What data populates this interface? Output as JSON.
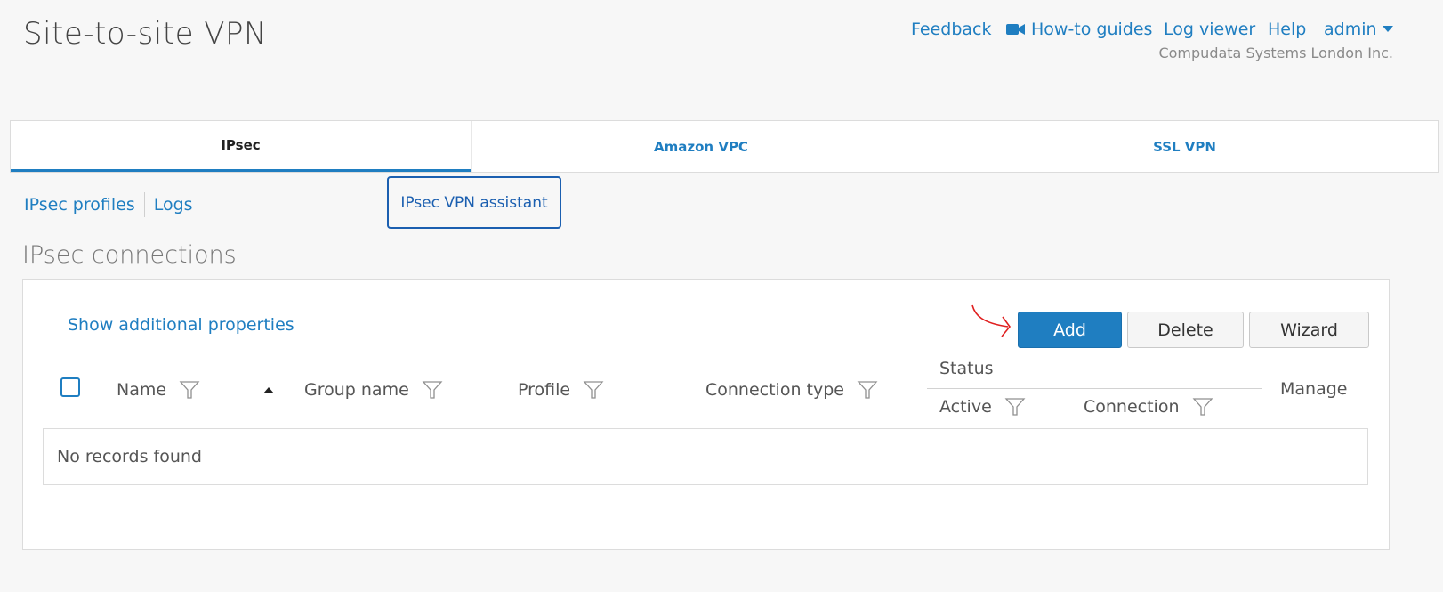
{
  "header": {
    "title": "Site-to-site VPN",
    "links": {
      "feedback": "Feedback",
      "howto": "How-to guides",
      "logviewer": "Log viewer",
      "help": "Help",
      "user": "admin"
    },
    "company": "Compudata Systems London Inc."
  },
  "tabs": [
    {
      "label": "IPsec",
      "active": true
    },
    {
      "label": "Amazon VPC",
      "active": false
    },
    {
      "label": "SSL VPN",
      "active": false
    }
  ],
  "subnav": {
    "profiles": "IPsec profiles",
    "logs": "Logs",
    "assistant": "IPsec VPN assistant"
  },
  "section": {
    "title": "IPsec connections",
    "show_props": "Show additional properties",
    "buttons": {
      "add": "Add",
      "delete": "Delete",
      "wizard": "Wizard"
    },
    "table": {
      "columns": {
        "name": "Name",
        "group": "Group name",
        "profile": "Profile",
        "conn_type": "Connection type",
        "status": "Status",
        "active": "Active",
        "connection": "Connection",
        "manage": "Manage"
      },
      "empty": "No records found"
    }
  },
  "colors": {
    "accent": "#1f7ec1",
    "highlight_border": "#1b5fb0",
    "annotation": "#e02020"
  }
}
